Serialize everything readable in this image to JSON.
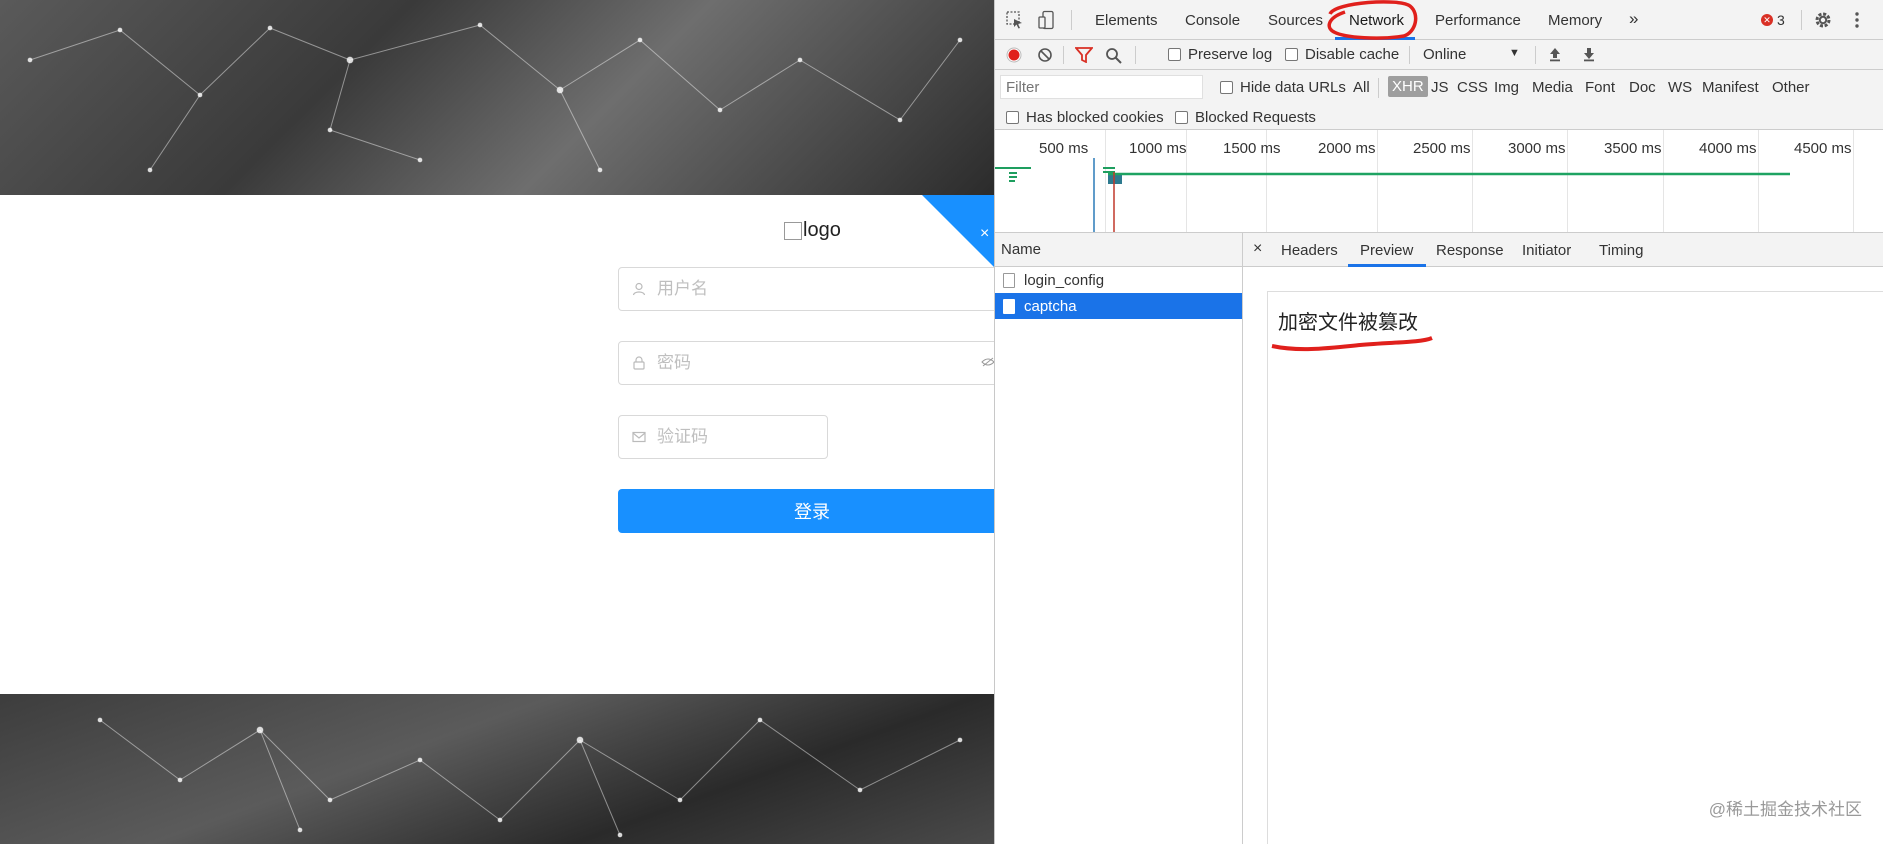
{
  "login_page": {
    "logo_text": "logo",
    "username_placeholder": "用户名",
    "password_placeholder": "密码",
    "captcha_placeholder": "验证码",
    "login_button": "登录",
    "corner_close": "×"
  },
  "devtools": {
    "tabs": [
      "Elements",
      "Console",
      "Sources",
      "Network",
      "Performance",
      "Memory"
    ],
    "more_tabs": "»",
    "error_count": "3",
    "toolbar": {
      "preserve_log": "Preserve log",
      "disable_cache": "Disable cache",
      "throttling": "Online"
    },
    "filter": {
      "placeholder": "Filter",
      "hide_data_urls": "Hide data URLs",
      "types": [
        "All",
        "XHR",
        "JS",
        "CSS",
        "Img",
        "Media",
        "Font",
        "Doc",
        "WS",
        "Manifest",
        "Other"
      ],
      "active_type": "XHR",
      "has_blocked_cookies": "Has blocked cookies",
      "blocked_requests": "Blocked Requests"
    },
    "timeline_labels": [
      "500 ms",
      "1000 ms",
      "1500 ms",
      "2000 ms",
      "2500 ms",
      "3000 ms",
      "3500 ms",
      "4000 ms",
      "4500 ms"
    ],
    "request_list": {
      "header": "Name",
      "requests": [
        "login_config",
        "captcha"
      ],
      "selected": "captcha"
    },
    "detail": {
      "close": "×",
      "tabs": [
        "Headers",
        "Preview",
        "Response",
        "Initiator",
        "Timing"
      ],
      "active_tab": "Preview",
      "preview_text": "加密文件被篡改"
    },
    "watermark": "@稀土掘金技术社区"
  },
  "colors": {
    "primary_button": "#1890ff",
    "devtools_accent": "#1a73e8",
    "annotation_red": "#e0201c"
  }
}
